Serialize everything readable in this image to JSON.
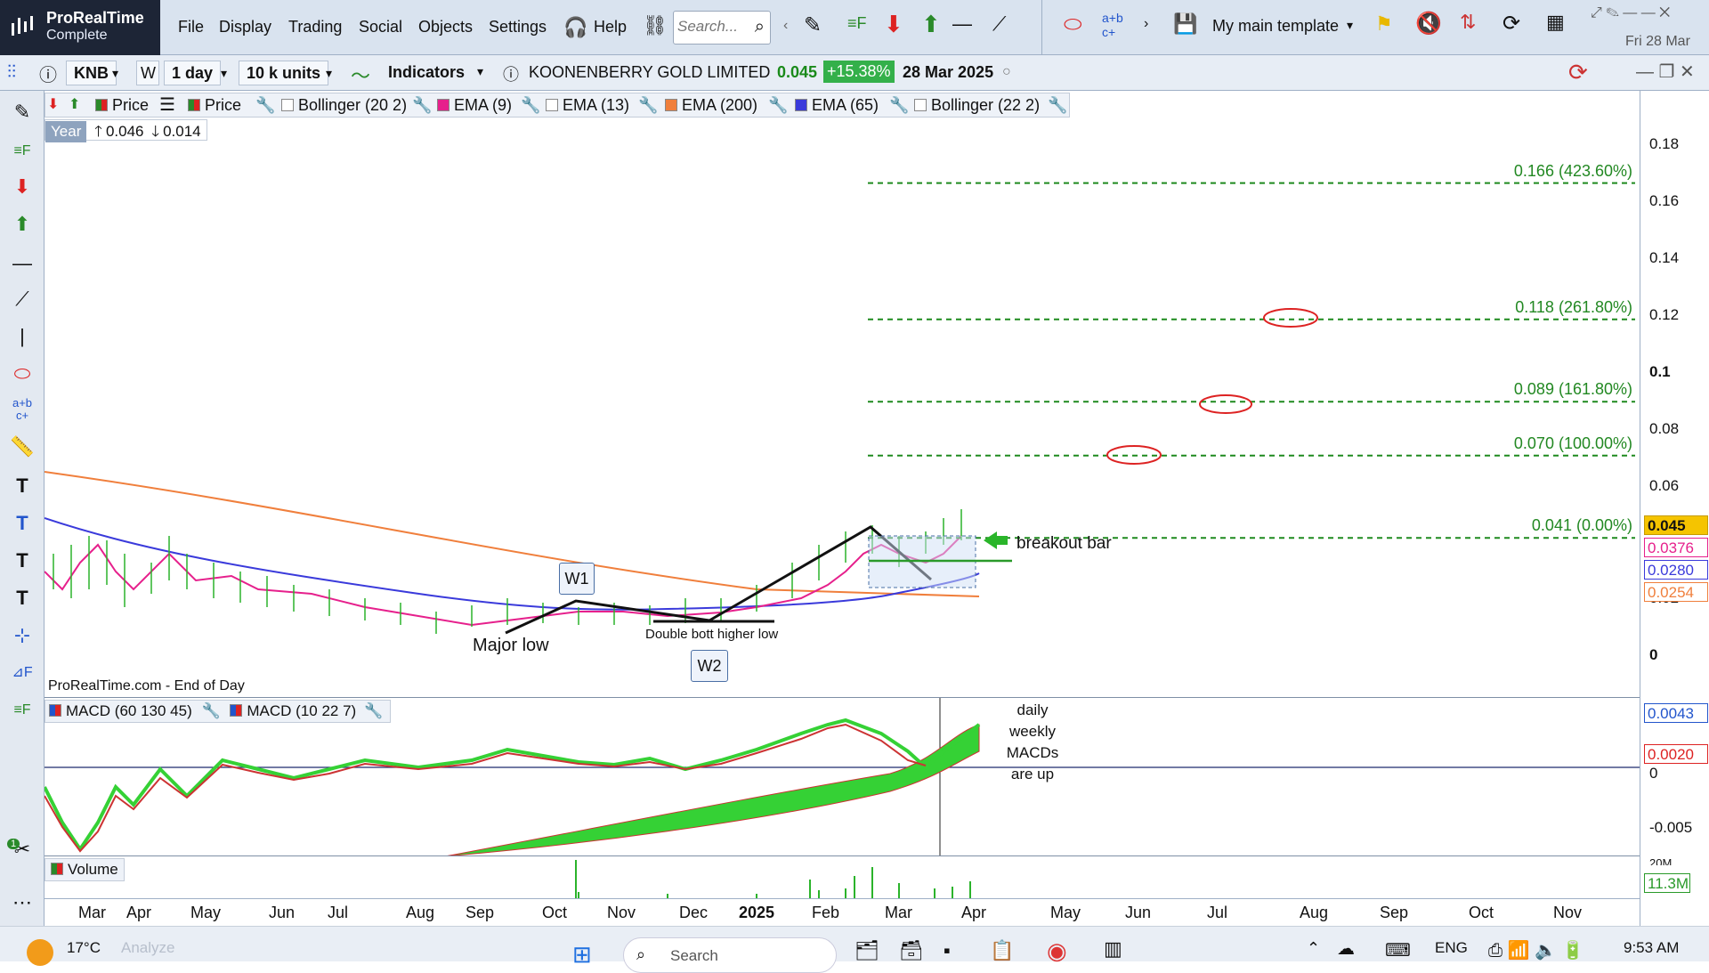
{
  "app": {
    "brand": "ProRealTime",
    "edition": "Complete"
  },
  "menu": [
    "File",
    "Display",
    "Trading",
    "Social",
    "Objects",
    "Settings",
    "Help"
  ],
  "search": {
    "placeholder": "Search..."
  },
  "template": {
    "label": "My main template"
  },
  "clock_top": {
    "date": "Fri 28 Mar"
  },
  "security": {
    "ticker": "KNB",
    "period": "1 day",
    "units": "10 k units",
    "indicators_label": "Indicators",
    "name": "KOONENBERRY GOLD LIMITED",
    "price": "0.045",
    "change": "+15.38%",
    "date": "28 Mar 2025"
  },
  "legend": {
    "items": [
      {
        "label": "Price",
        "color": "#cc3333"
      },
      {
        "label": "Price",
        "color": "#cc3333"
      },
      {
        "label": "Bollinger (20 2)",
        "color": "#ffffff"
      },
      {
        "label": "EMA (9)",
        "color": "#e6208c"
      },
      {
        "label": "EMA (13)",
        "color": "#ffffff"
      },
      {
        "label": "EMA (200)",
        "color": "#f07f3c"
      },
      {
        "label": "EMA (65)",
        "color": "#3a3adb"
      },
      {
        "label": "Bollinger (22 2)",
        "color": "#ffffff"
      }
    ],
    "range_label": "Year",
    "range_high": "0.046",
    "range_low": "0.014"
  },
  "price_axis": {
    "ticks": [
      "0.18",
      "0.16",
      "0.14",
      "0.12",
      "0.1",
      "0.08",
      "0.06",
      "0.02",
      "0"
    ],
    "current": "0.045",
    "ema9": "0.0376",
    "ema65": "0.0280",
    "ema200": "0.0254"
  },
  "fib_levels": [
    {
      "label": "0.166 (423.60%)",
      "value": 0.166
    },
    {
      "label": "0.118 (261.80%)",
      "value": 0.118
    },
    {
      "label": "0.089 (161.80%)",
      "value": 0.089
    },
    {
      "label": "0.070 (100.00%)",
      "value": 0.07
    },
    {
      "label": "0.041 (0.00%)",
      "value": 0.041
    }
  ],
  "annotations": {
    "major_low": "Major low",
    "w1": "W1",
    "w2": "W2",
    "double_bottom": "Double bott higher low",
    "breakout": "breakout bar",
    "macd_note": [
      "daily",
      "weekly",
      "MACDs",
      "are up"
    ],
    "source": "ProRealTime.com - End of Day"
  },
  "macd": {
    "legend": [
      "MACD (60 130 45)",
      "MACD (10 22 7)"
    ],
    "ticks": [
      "0",
      "-0.005"
    ],
    "values": [
      "0.0043",
      "0.0020"
    ]
  },
  "volume": {
    "label": "Volume",
    "value": "11.3M",
    "tick": "20M"
  },
  "time_axis": [
    "Mar",
    "Apr",
    "May",
    "Jun",
    "Jul",
    "Aug",
    "Sep",
    "Oct",
    "Nov",
    "Dec",
    "2025",
    "Feb",
    "Mar",
    "Apr",
    "May",
    "Jun",
    "Jul",
    "Aug",
    "Sep",
    "Oct",
    "Nov"
  ],
  "taskbar": {
    "temp": "17°C",
    "analyze": "Analyze",
    "search": "Search",
    "lang": "ENG",
    "time": "9:53 AM"
  },
  "tool_badge": "1"
}
